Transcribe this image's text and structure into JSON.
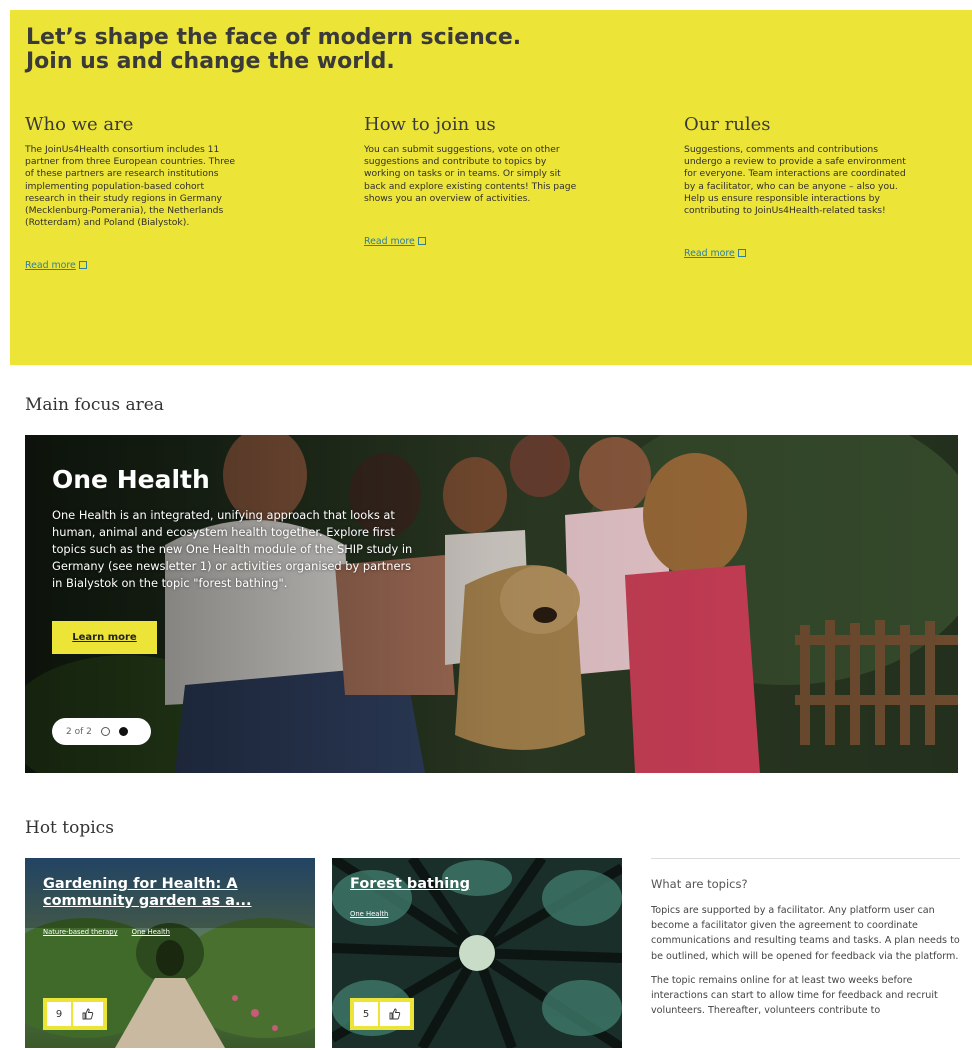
{
  "hero": {
    "title_line1": "Let’s shape the face of modern science.",
    "title_line2": "Join us and change the world.",
    "columns": [
      {
        "heading": "Who we are",
        "text": "The JoinUs4Health consortium includes 11 partner from three European countries. Three of these partners are research institutions implementing population-based cohort research in their study regions in Germany (Mecklenburg-Pomerania), the Netherlands (Rotterdam) and Poland (Bialystok).",
        "link": "Read more"
      },
      {
        "heading": "How to join us",
        "text": "You can submit suggestions, vote on other suggestions and contribute to topics by working on tasks or in teams. Or simply sit back and explore existing contents! This page shows you an overview of activities.",
        "link": "Read more"
      },
      {
        "heading": "Our rules",
        "text": "Suggestions, comments and contributions undergo a review to provide a safe environment for everyone. Team interactions are coordinated by a facilitator, who can be anyone – also you. Help us ensure responsible interactions by contributing to JoinUs4Health-related tasks!",
        "link": "Read more"
      }
    ]
  },
  "focus": {
    "heading": "Main focus area",
    "banner": {
      "title": "One Health",
      "text": "One Health is an integrated, unifying approach that looks at human, animal and ecosystem health together. Explore first topics such as the new One Health module of the SHIP study in Germany (see newsletter 1) or activities organised by partners in Bialystok on the topic \"forest bathing\".",
      "button": "Learn more",
      "pager": "2 of 2"
    }
  },
  "hot_topics": {
    "heading": "Hot topics",
    "cards": [
      {
        "title": "Gardening for Health: A community garden as a...",
        "tags": [
          "Nature-based therapy",
          "One Health"
        ],
        "likes": "9"
      },
      {
        "title": "Forest bathing",
        "tags": [
          "One Health"
        ],
        "likes": "5"
      }
    ],
    "info": {
      "heading": "What are topics?",
      "p1": "Topics are supported by a facilitator. Any platform user can become a facilitator given the agreement to coordinate communications and resulting teams and tasks. A plan needs to be outlined, which will be opened for feedback via the platform.",
      "p2": "The topic remains online for at least two weeks before interactions can start to allow time for feedback and recruit volunteers. Thereafter, volunteers contribute to"
    }
  },
  "colors": {
    "accent": "#ede438",
    "link": "#2e7f9b"
  },
  "icons": [
    "external-link-icon",
    "thumbs-up-icon"
  ]
}
